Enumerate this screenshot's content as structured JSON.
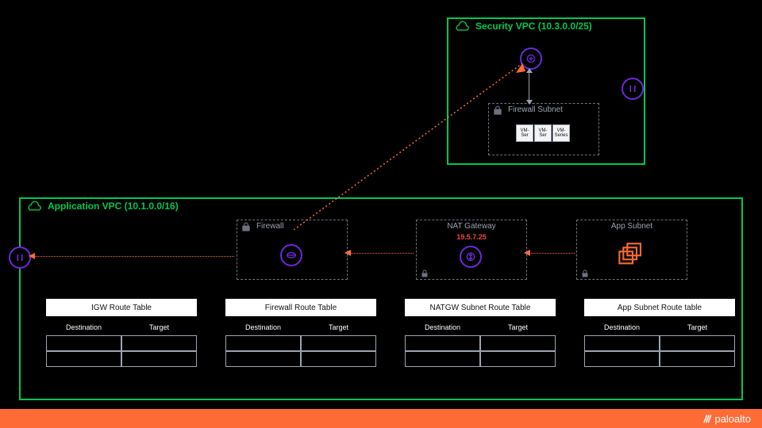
{
  "security_vpc": {
    "label": "Security VPC  (10.3.0.0/25)",
    "firewall_subnet": {
      "label": "Firewall Subnet"
    },
    "vm_series": [
      "VM-Ser",
      "VM-Ser",
      "VM-Series"
    ]
  },
  "application_vpc": {
    "label": "Application VPC    (10.1.0.0/16)",
    "firewall": {
      "label": "Firewall"
    },
    "nat_gateway": {
      "label": "NAT Gateway",
      "ip": "19.5.7.25"
    },
    "app_subnet": {
      "label": "App Subnet"
    }
  },
  "route_tables": {
    "igw": {
      "title": "IGW Route Table",
      "col1": "Destination",
      "col2": "Target"
    },
    "firewall": {
      "title": "Firewall Route Table",
      "col1": "Destination",
      "col2": "Target"
    },
    "natgw": {
      "title": "NATGW Subnet Route Table",
      "col1": "Destination",
      "col2": "Target"
    },
    "app": {
      "title": "App Subnet Route table",
      "col1": "Destination",
      "col2": "Target"
    }
  },
  "footer": {
    "brand": "paloalto",
    "mark": "///"
  },
  "chart_data": {
    "type": "table",
    "note": "Network architecture diagram with two VPCs and four empty route tables.",
    "vpcs": [
      {
        "name": "Security VPC",
        "cidr": "10.3.0.0/25",
        "subnets": [
          "Firewall Subnet"
        ],
        "components": [
          "Gateway endpoint",
          "VM-Series (x3)",
          "Internet Gateway"
        ]
      },
      {
        "name": "Application VPC",
        "cidr": "10.1.0.0/16",
        "subnets": [
          "Firewall",
          "NAT Gateway",
          "App Subnet"
        ],
        "components": [
          "Internet Gateway",
          "Firewall endpoint",
          "NAT Gateway (19.5.7.25)",
          "App servers"
        ]
      }
    ],
    "route_tables": [
      {
        "name": "IGW Route Table",
        "columns": [
          "Destination",
          "Target"
        ],
        "rows": [
          [
            "",
            ""
          ],
          [
            "",
            ""
          ]
        ]
      },
      {
        "name": "Firewall Route Table",
        "columns": [
          "Destination",
          "Target"
        ],
        "rows": [
          [
            "",
            ""
          ],
          [
            "",
            ""
          ]
        ]
      },
      {
        "name": "NATGW Subnet Route Table",
        "columns": [
          "Destination",
          "Target"
        ],
        "rows": [
          [
            "",
            ""
          ],
          [
            "",
            ""
          ]
        ]
      },
      {
        "name": "App Subnet Route table",
        "columns": [
          "Destination",
          "Target"
        ],
        "rows": [
          [
            "",
            ""
          ],
          [
            "",
            ""
          ]
        ]
      }
    ],
    "flows": [
      "App Subnet → NAT Gateway",
      "NAT Gateway → Firewall (App VPC)",
      "Firewall (App VPC) → IGW (App VPC)",
      "Firewall (App VPC) → Gateway endpoint (Security VPC)",
      "Gateway endpoint ↔ Firewall Subnet (Security VPC)"
    ]
  }
}
